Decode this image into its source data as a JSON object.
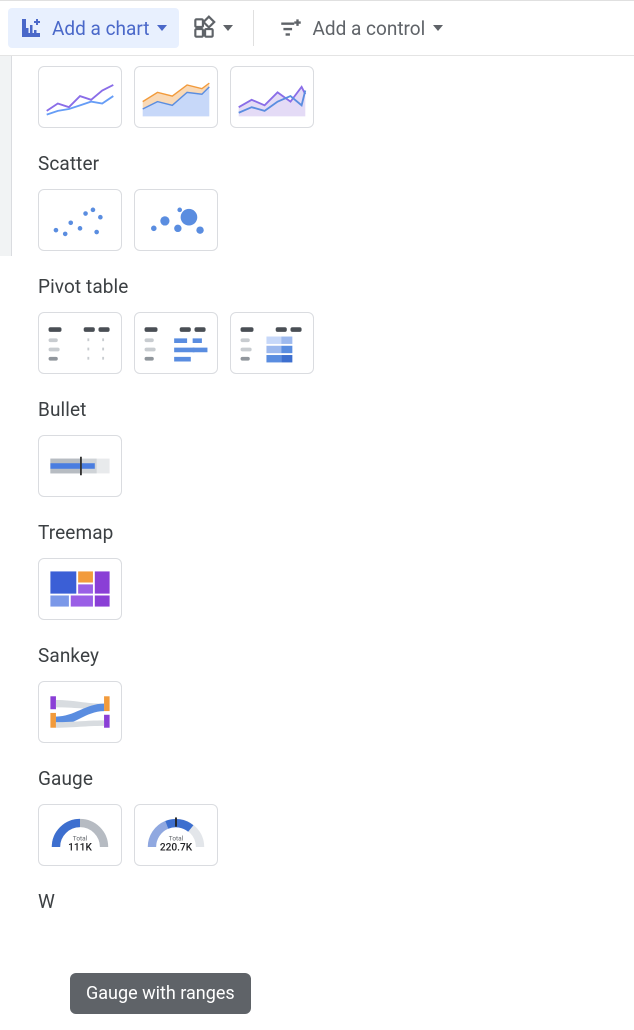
{
  "toolbar": {
    "addChart": "Add a chart",
    "addControl": "Add a control"
  },
  "sections": {
    "scatter": "Scatter",
    "pivot": "Pivot table",
    "bullet": "Bullet",
    "treemap": "Treemap",
    "sankey": "Sankey",
    "gauge": "Gauge",
    "waterfall": "W"
  },
  "gauge": {
    "label1": "Total",
    "value1": "111K",
    "label2": "Total",
    "value2": "220.7K"
  },
  "tooltip": "Gauge with ranges"
}
